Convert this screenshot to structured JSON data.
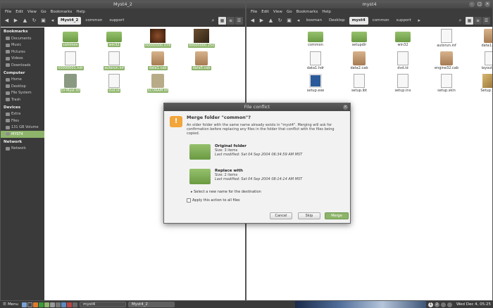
{
  "left_window": {
    "title": "Myst4_2",
    "menu": [
      "File",
      "Edit",
      "View",
      "Go",
      "Bookmarks",
      "Help"
    ],
    "breadcrumbs": [
      "Myst4_2",
      "common",
      "support"
    ],
    "sidebar": {
      "sections": [
        {
          "header": "Bookmarks",
          "items": [
            "Documents",
            "Music",
            "Pictures",
            "Videos",
            "Downloads"
          ]
        },
        {
          "header": "Computer",
          "items": [
            "Home",
            "Desktop",
            "File System",
            "Trash"
          ]
        },
        {
          "header": "Devices",
          "items": [
            "Extra",
            "Files",
            "131 GB Volume",
            "MYST4"
          ]
        },
        {
          "header": "Network",
          "items": [
            "Network"
          ]
        }
      ],
      "selected": "MYST4"
    },
    "files": [
      {
        "name": "common",
        "type": "folder"
      },
      {
        "name": "win32",
        "type": "folder"
      },
      {
        "name": "00000000.078",
        "type": "img1"
      },
      {
        "name": "00000000.250",
        "type": "img2"
      },
      {
        "name": "00000001.hdr",
        "type": "doc"
      },
      {
        "name": "autorun.inf",
        "type": "doc"
      },
      {
        "name": "data1.cab",
        "type": "cab"
      },
      {
        "name": "data5.cab",
        "type": "cab"
      },
      {
        "name": "Dr-Myst.ttf",
        "type": "dr"
      },
      {
        "name": "dvd.id",
        "type": "doc"
      },
      {
        "name": "SCORAM.ttf",
        "type": "sc"
      }
    ]
  },
  "right_window": {
    "title": "myst4",
    "menu": [
      "File",
      "Edit",
      "View",
      "Go",
      "Bookmarks",
      "Help"
    ],
    "breadcrumbs": [
      "bosman",
      "Desktop",
      "myst4",
      "common",
      "support"
    ],
    "files": [
      {
        "name": "common",
        "type": "folder"
      },
      {
        "name": "setupdir",
        "type": "folder"
      },
      {
        "name": "win32",
        "type": "folder"
      },
      {
        "name": "autorun.inf",
        "type": "doc"
      },
      {
        "name": "data1.cab",
        "type": "cab"
      },
      {
        "name": "data1.hdr",
        "type": "doc"
      },
      {
        "name": "data2.cab",
        "type": "cab"
      },
      {
        "name": "dvd.id",
        "type": "doc"
      },
      {
        "name": "engine32.cab",
        "type": "cab"
      },
      {
        "name": "layout.bin",
        "type": "doc"
      },
      {
        "name": "setup.exe",
        "type": "exe"
      },
      {
        "name": "setup.ibt",
        "type": "doc"
      },
      {
        "name": "setup.inx",
        "type": "doc"
      },
      {
        "name": "setup.skin",
        "type": "doc"
      },
      {
        "name": "Setup.bmp",
        "type": "bmp"
      }
    ]
  },
  "dialog": {
    "title": "File conflict",
    "heading": "Merge folder \"common\"?",
    "message": "An older folder with the same name already exists in \"myst4\". Merging will ask for confirmation before replacing any files in the folder that conflict with the files being copied.",
    "original": {
      "label": "Original folder",
      "size": "Size: 3 items",
      "modified": "Last modified: Sat 04 Sep 2004 06:34:59 AM MST"
    },
    "replace": {
      "label": "Replace with",
      "size": "Size: 2 items",
      "modified": "Last modified: Sat 04 Sep 2004 08:14:14 AM MST"
    },
    "new_name_expander": "Select a new name for the destination",
    "apply_all": "Apply this action to all files",
    "buttons": {
      "cancel": "Cancel",
      "skip": "Skip",
      "merge": "Merge"
    }
  },
  "taskbar": {
    "menu_label": "Menu",
    "tasks": [
      "myst4",
      "Myst4_2"
    ],
    "clock": "Wed Dec 4, 05:25",
    "workspace": "1",
    "workspace2": "2"
  }
}
